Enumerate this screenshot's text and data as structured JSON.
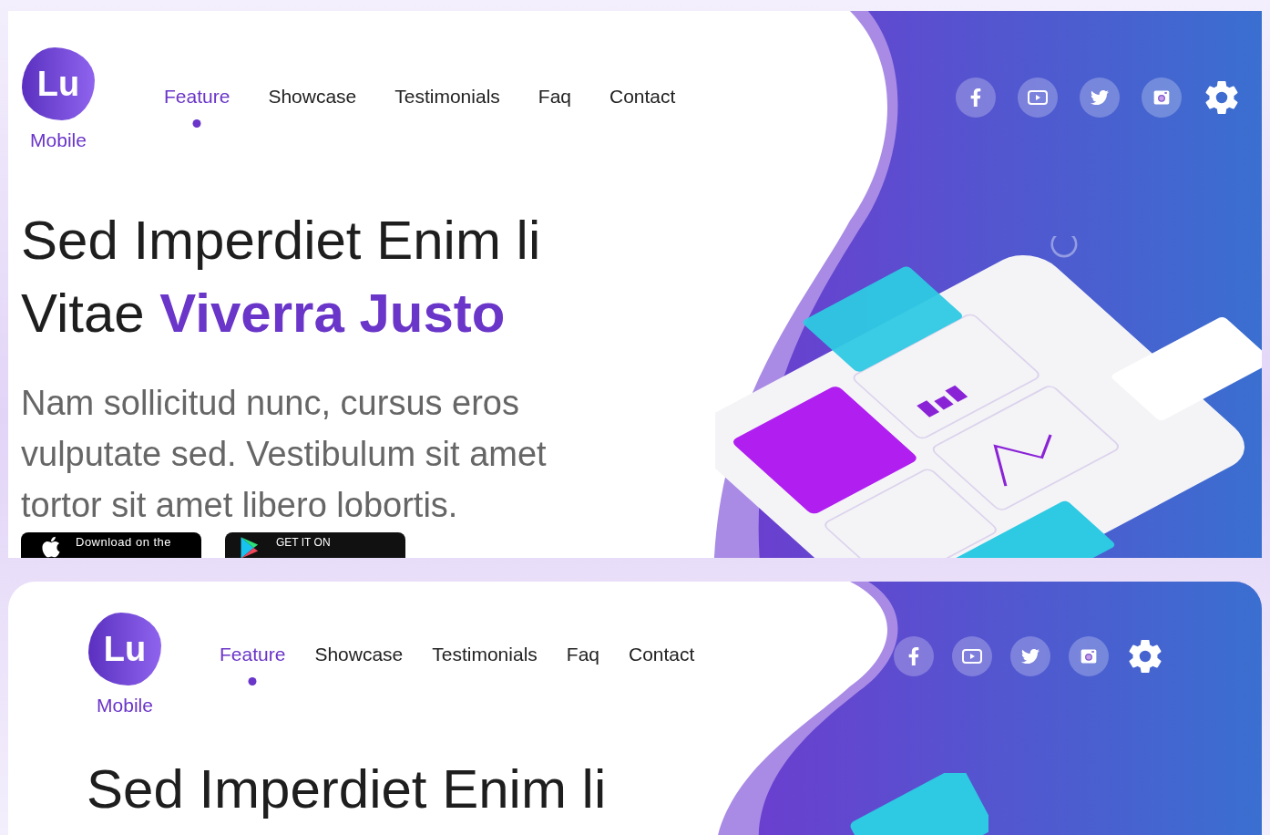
{
  "screens": [
    {
      "logo": {
        "mark": "Lu",
        "name": "Mobile"
      },
      "nav": [
        {
          "label": "Feature",
          "selected": true
        },
        {
          "label": "Showcase",
          "selected": false
        },
        {
          "label": "Testimonials",
          "selected": false
        },
        {
          "label": "Faq",
          "selected": false
        },
        {
          "label": "Contact",
          "selected": false
        }
      ],
      "headline": [
        "Sed Imperdiet Enim li",
        "Vitae **Viverra Justo**"
      ],
      "description": "Nam sollicitud nunc, cursus eros vulputate sed. Vestibulum sit amet tortor sit amet libero lobortis.",
      "store_buttons": [
        {
          "kind": "apple",
          "label": "Download on the"
        },
        {
          "kind": "google",
          "label": "GET IT ON"
        }
      ]
    },
    {
      "logo": {
        "mark": "Lu",
        "name": "Mobile"
      },
      "nav": [
        {
          "label": "Feature",
          "selected": true
        },
        {
          "label": "Showcase",
          "selected": false
        },
        {
          "label": "Testimonials",
          "selected": false
        },
        {
          "label": "Faq",
          "selected": false
        },
        {
          "label": "Contact",
          "selected": false
        }
      ],
      "headline": [
        "Sed Imperdiet Enim li"
      ]
    }
  ]
}
